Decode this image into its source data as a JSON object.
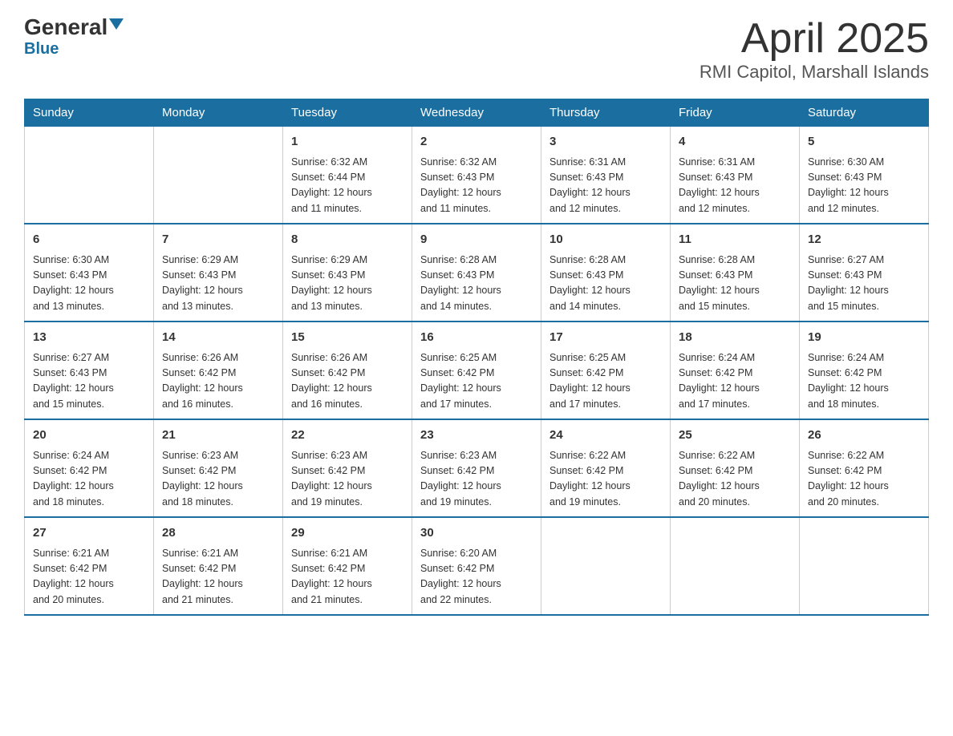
{
  "header": {
    "logo_general": "General",
    "logo_blue": "Blue",
    "title": "April 2025",
    "subtitle": "RMI Capitol, Marshall Islands"
  },
  "calendar": {
    "days_of_week": [
      "Sunday",
      "Monday",
      "Tuesday",
      "Wednesday",
      "Thursday",
      "Friday",
      "Saturday"
    ],
    "weeks": [
      [
        {
          "day": "",
          "info": ""
        },
        {
          "day": "",
          "info": ""
        },
        {
          "day": "1",
          "info": "Sunrise: 6:32 AM\nSunset: 6:44 PM\nDaylight: 12 hours\nand 11 minutes."
        },
        {
          "day": "2",
          "info": "Sunrise: 6:32 AM\nSunset: 6:43 PM\nDaylight: 12 hours\nand 11 minutes."
        },
        {
          "day": "3",
          "info": "Sunrise: 6:31 AM\nSunset: 6:43 PM\nDaylight: 12 hours\nand 12 minutes."
        },
        {
          "day": "4",
          "info": "Sunrise: 6:31 AM\nSunset: 6:43 PM\nDaylight: 12 hours\nand 12 minutes."
        },
        {
          "day": "5",
          "info": "Sunrise: 6:30 AM\nSunset: 6:43 PM\nDaylight: 12 hours\nand 12 minutes."
        }
      ],
      [
        {
          "day": "6",
          "info": "Sunrise: 6:30 AM\nSunset: 6:43 PM\nDaylight: 12 hours\nand 13 minutes."
        },
        {
          "day": "7",
          "info": "Sunrise: 6:29 AM\nSunset: 6:43 PM\nDaylight: 12 hours\nand 13 minutes."
        },
        {
          "day": "8",
          "info": "Sunrise: 6:29 AM\nSunset: 6:43 PM\nDaylight: 12 hours\nand 13 minutes."
        },
        {
          "day": "9",
          "info": "Sunrise: 6:28 AM\nSunset: 6:43 PM\nDaylight: 12 hours\nand 14 minutes."
        },
        {
          "day": "10",
          "info": "Sunrise: 6:28 AM\nSunset: 6:43 PM\nDaylight: 12 hours\nand 14 minutes."
        },
        {
          "day": "11",
          "info": "Sunrise: 6:28 AM\nSunset: 6:43 PM\nDaylight: 12 hours\nand 15 minutes."
        },
        {
          "day": "12",
          "info": "Sunrise: 6:27 AM\nSunset: 6:43 PM\nDaylight: 12 hours\nand 15 minutes."
        }
      ],
      [
        {
          "day": "13",
          "info": "Sunrise: 6:27 AM\nSunset: 6:43 PM\nDaylight: 12 hours\nand 15 minutes."
        },
        {
          "day": "14",
          "info": "Sunrise: 6:26 AM\nSunset: 6:42 PM\nDaylight: 12 hours\nand 16 minutes."
        },
        {
          "day": "15",
          "info": "Sunrise: 6:26 AM\nSunset: 6:42 PM\nDaylight: 12 hours\nand 16 minutes."
        },
        {
          "day": "16",
          "info": "Sunrise: 6:25 AM\nSunset: 6:42 PM\nDaylight: 12 hours\nand 17 minutes."
        },
        {
          "day": "17",
          "info": "Sunrise: 6:25 AM\nSunset: 6:42 PM\nDaylight: 12 hours\nand 17 minutes."
        },
        {
          "day": "18",
          "info": "Sunrise: 6:24 AM\nSunset: 6:42 PM\nDaylight: 12 hours\nand 17 minutes."
        },
        {
          "day": "19",
          "info": "Sunrise: 6:24 AM\nSunset: 6:42 PM\nDaylight: 12 hours\nand 18 minutes."
        }
      ],
      [
        {
          "day": "20",
          "info": "Sunrise: 6:24 AM\nSunset: 6:42 PM\nDaylight: 12 hours\nand 18 minutes."
        },
        {
          "day": "21",
          "info": "Sunrise: 6:23 AM\nSunset: 6:42 PM\nDaylight: 12 hours\nand 18 minutes."
        },
        {
          "day": "22",
          "info": "Sunrise: 6:23 AM\nSunset: 6:42 PM\nDaylight: 12 hours\nand 19 minutes."
        },
        {
          "day": "23",
          "info": "Sunrise: 6:23 AM\nSunset: 6:42 PM\nDaylight: 12 hours\nand 19 minutes."
        },
        {
          "day": "24",
          "info": "Sunrise: 6:22 AM\nSunset: 6:42 PM\nDaylight: 12 hours\nand 19 minutes."
        },
        {
          "day": "25",
          "info": "Sunrise: 6:22 AM\nSunset: 6:42 PM\nDaylight: 12 hours\nand 20 minutes."
        },
        {
          "day": "26",
          "info": "Sunrise: 6:22 AM\nSunset: 6:42 PM\nDaylight: 12 hours\nand 20 minutes."
        }
      ],
      [
        {
          "day": "27",
          "info": "Sunrise: 6:21 AM\nSunset: 6:42 PM\nDaylight: 12 hours\nand 20 minutes."
        },
        {
          "day": "28",
          "info": "Sunrise: 6:21 AM\nSunset: 6:42 PM\nDaylight: 12 hours\nand 21 minutes."
        },
        {
          "day": "29",
          "info": "Sunrise: 6:21 AM\nSunset: 6:42 PM\nDaylight: 12 hours\nand 21 minutes."
        },
        {
          "day": "30",
          "info": "Sunrise: 6:20 AM\nSunset: 6:42 PM\nDaylight: 12 hours\nand 22 minutes."
        },
        {
          "day": "",
          "info": ""
        },
        {
          "day": "",
          "info": ""
        },
        {
          "day": "",
          "info": ""
        }
      ]
    ]
  }
}
